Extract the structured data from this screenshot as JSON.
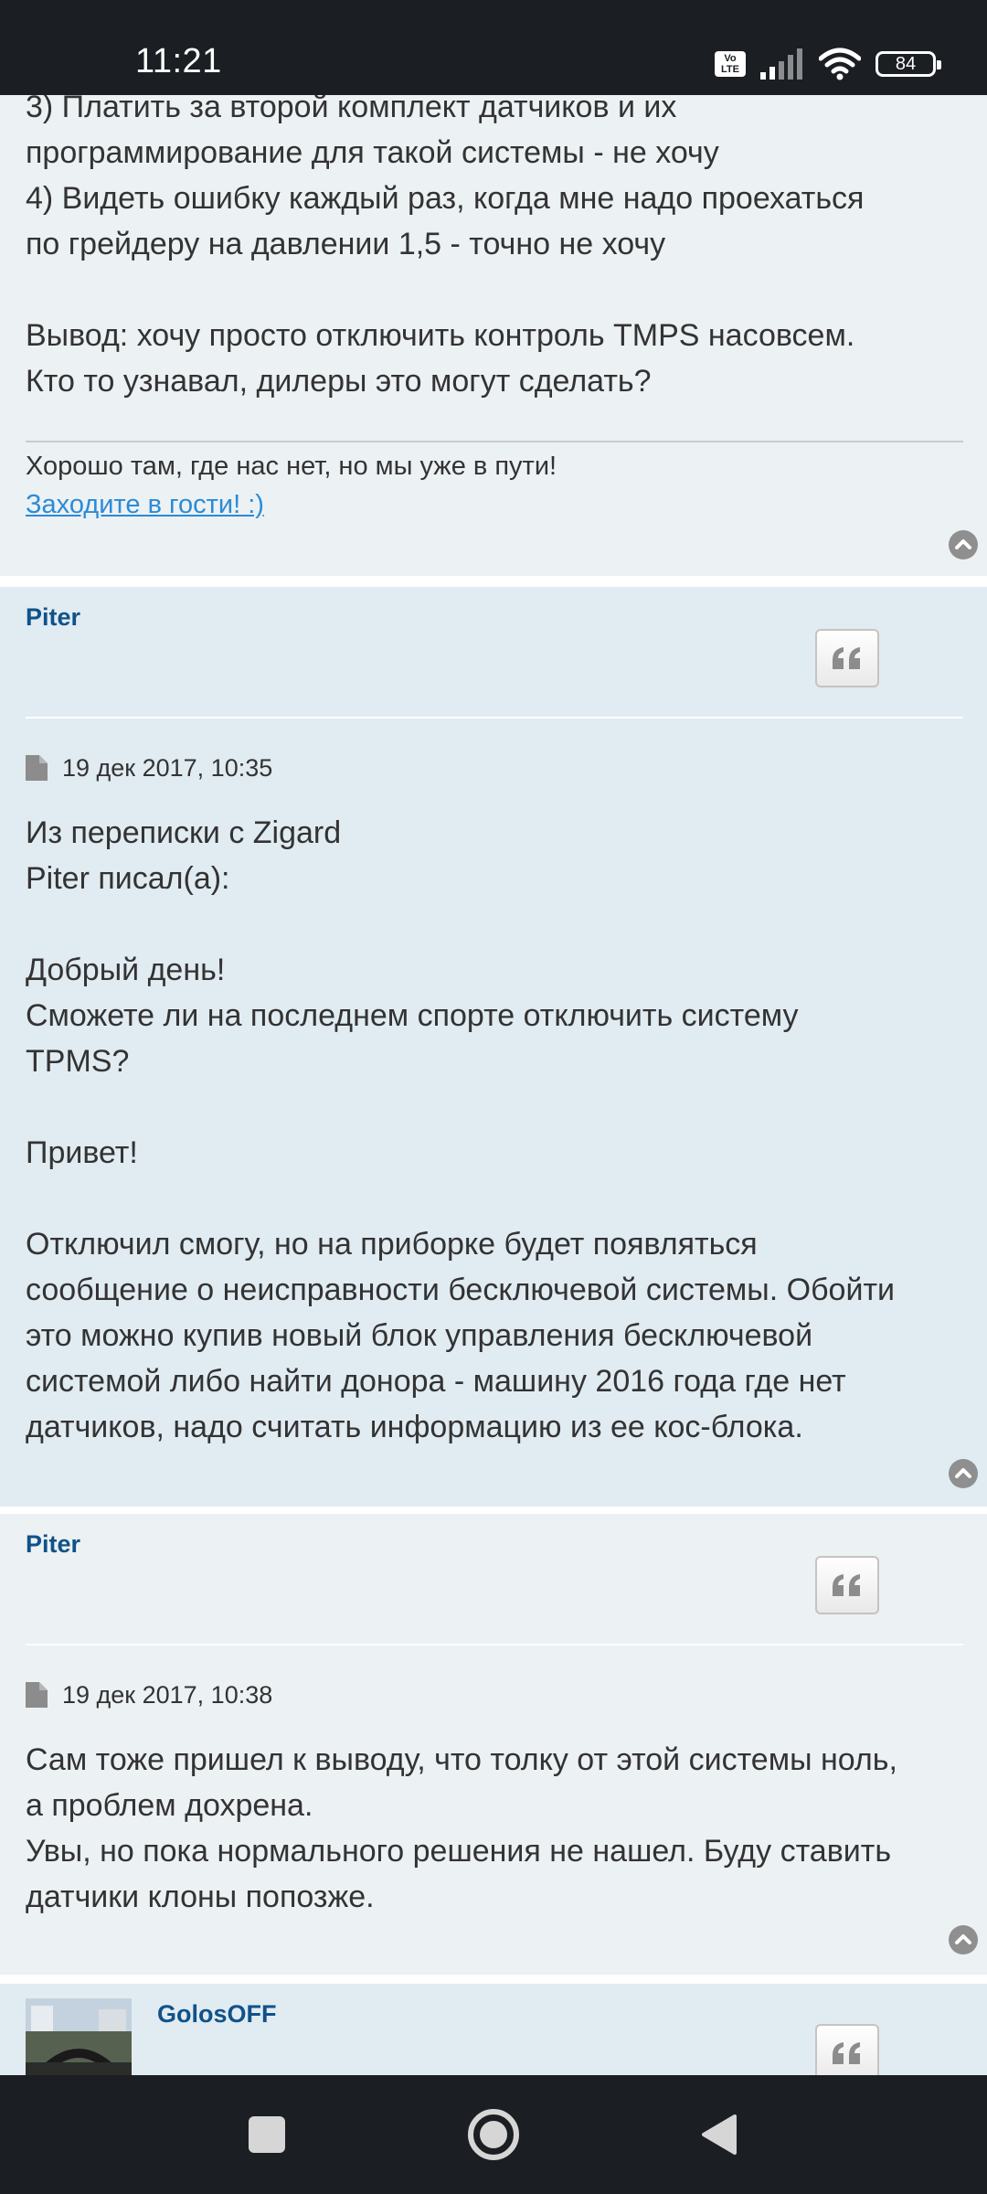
{
  "status_bar": {
    "time": "11:21",
    "volte": "Vo LTE",
    "battery": "84"
  },
  "post1": {
    "lines": "3) Платить за второй комплект датчиков и их\nпрограммирование для такой системы - не хочу\n4) Видеть ошибку каждый раз, когда мне надо проехаться\nпо грейдеру на давлении 1,5 - точно не хочу\n\nВывод: хочу просто отключить контроль TMPS насовсем.\nКто то узнавал, дилеры это могут сделать?",
    "signature": "Хорошо там, где нас нет, но мы уже в пути!",
    "signature_link": "Заходите в гости! :)"
  },
  "post2": {
    "author": "Piter",
    "date": "19 дек 2017, 10:35",
    "body": "Из переписки с Zigard\nPiter писал(а):\n\nДобрый день!\nСможете ли на последнем спорте отключить систему\nTPMS?\n\nПривет!\n\nОтключил смогу, но на приборке будет появляться\nсообщение о неисправности бесключевой системы. Обойти\nэто можно купив новый блок управления бесключевой\nсистемой либо найти донора - машину 2016 года где нет\nдатчиков, надо считать информацию из ее кос-блока."
  },
  "post3": {
    "author": "Piter",
    "date": "19 дек 2017, 10:38",
    "body": "Сам тоже пришел к выводу, что толку от этой системы ноль,\nа проблем дохрена.\nУвы, но пока нормального решения не нашел. Буду ставить\nдатчики клоны попозже."
  },
  "post4": {
    "author": "GolosOFF"
  },
  "colors": {
    "author_link": "#105289",
    "signature_link": "#2b8bd6",
    "post_light_bg": "#ecf1f3",
    "post_dark_bg": "#e1ebf2"
  },
  "icons": {
    "quote": "quote-icon",
    "back_to_top": "chevron-up-circle-icon",
    "post_file": "file-icon"
  }
}
